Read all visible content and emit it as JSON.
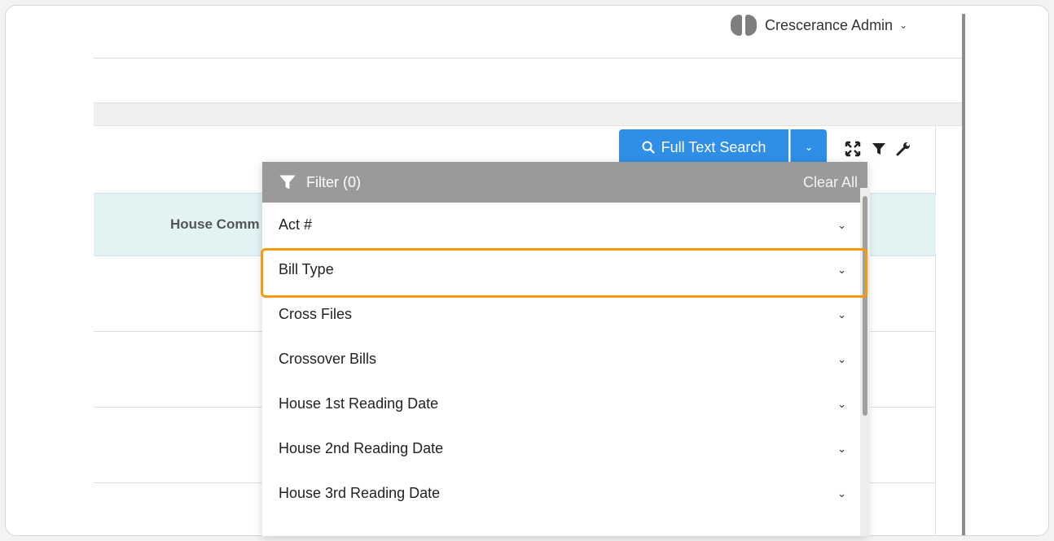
{
  "header": {
    "user_name": "Crescerance Admin",
    "user_caret": "⌄"
  },
  "toolbar": {
    "search_button_label": "Full Text Search",
    "search_caret": "⌄"
  },
  "table": {
    "column_header": "House Comm"
  },
  "filter": {
    "title": "Filter (0)",
    "clear_label": "Clear All",
    "items": [
      {
        "label": "Act #",
        "caret": "⌄"
      },
      {
        "label": "Bill Type",
        "caret": "⌄"
      },
      {
        "label": "Cross Files",
        "caret": "⌄"
      },
      {
        "label": "Crossover Bills",
        "caret": "⌄"
      },
      {
        "label": "House 1st Reading Date",
        "caret": "⌄"
      },
      {
        "label": "House 2nd Reading Date",
        "caret": "⌄"
      },
      {
        "label": "House 3rd Reading Date",
        "caret": "⌄"
      }
    ]
  },
  "colors": {
    "accent": "#2f8fe6",
    "highlight": "#f59a0f",
    "table_header": "#e3f3f4",
    "filter_header": "#9a9a9a"
  },
  "icons": [
    "filter-icon",
    "search-icon",
    "expand-icon",
    "wrench-icon",
    "chevron-down-icon"
  ]
}
